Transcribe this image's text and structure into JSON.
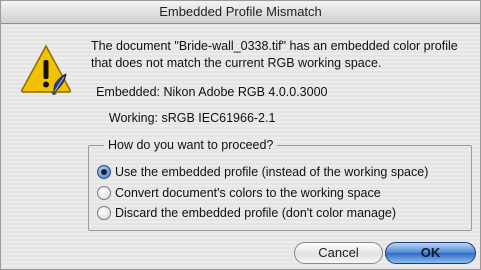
{
  "dialog": {
    "title": "Embedded Profile Mismatch",
    "message": "The document \"Bride-wall_0338.tif\" has an embedded color profile that does not match the current RGB working space.",
    "embedded_label": "Embedded:",
    "embedded_value": "Nikon Adobe RGB 4.0.0.3000",
    "working_label": "Working:",
    "working_value": "sRGB IEC61966-2.1",
    "icon": "warning-icon",
    "proceed": {
      "legend": "How do you want to proceed?",
      "options": [
        {
          "label": "Use the embedded profile (instead of the working space)",
          "selected": true
        },
        {
          "label": "Convert document's colors to the working space",
          "selected": false
        },
        {
          "label": "Discard the embedded profile (don't color manage)",
          "selected": false
        }
      ]
    },
    "buttons": {
      "cancel": "Cancel",
      "ok": "OK"
    },
    "colors": {
      "accent": "#3f78c4",
      "warning_yellow": "#f2c200"
    }
  }
}
